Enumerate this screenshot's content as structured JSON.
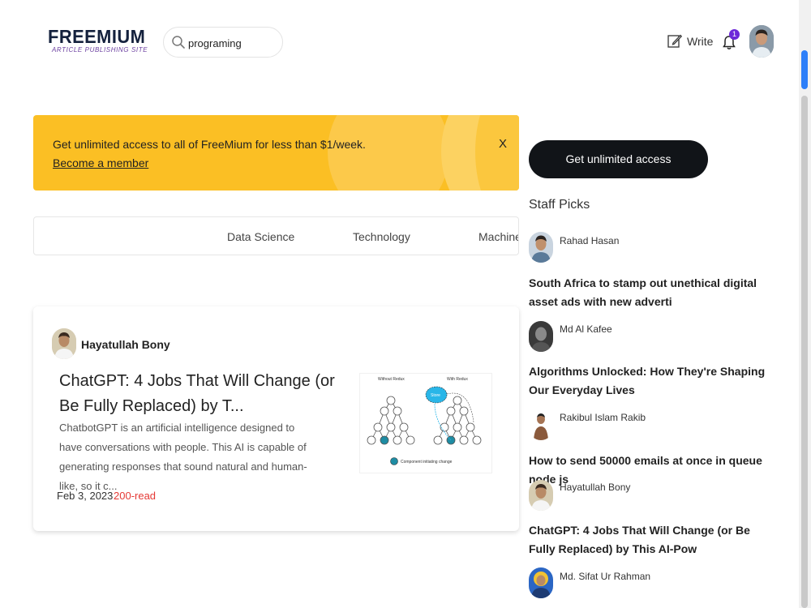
{
  "header": {
    "logo_title": "FREEMIUM",
    "logo_subtitle": "ARTICLE PUBLISHING SITE",
    "search_value": "programing",
    "write_label": "Write",
    "notification_count": "1"
  },
  "banner": {
    "text": "Get unlimited access to all of FreeMium for less than $1/week.",
    "link": "Become a member",
    "close": "X",
    "color": "#fbbf24"
  },
  "categories": [
    "Data Science",
    "Technology",
    "Machine L"
  ],
  "article": {
    "author": "Hayatullah Bony",
    "title": "ChatGPT: 4 Jobs That Will Change (or Be Fully Replaced) by T...",
    "excerpt": "ChatbotGPT is an artificial intelligence designed to have conversations with people. This AI is capable of generating responses that sound natural and human-like, so it c...",
    "date": "Feb 3, 2023",
    "reads": "200-read",
    "thumb_labels": {
      "left": "Without Redux",
      "right": "With Redux",
      "store": "Store",
      "legend": "Component initiating change"
    }
  },
  "sidebar": {
    "cta": "Get unlimited access",
    "staff_title": "Staff Picks",
    "picks": [
      {
        "author": "Rahad Hasan",
        "title": "South Africa to stamp out unethical digital asset ads with new adverti"
      },
      {
        "author": "Md Al Kafee",
        "title": "Algorithms Unlocked: How They're Shaping Our Everyday Lives"
      },
      {
        "author": "Rakibul Islam Rakib",
        "title": "How to send 50000 emails at once in queue node js"
      },
      {
        "author": "Hayatullah Bony",
        "title": "ChatGPT: 4 Jobs That Will Change (or Be Fully Replaced) by This AI-Pow"
      },
      {
        "author": "Md. Sifat Ur Rahman",
        "title": ""
      }
    ]
  },
  "colors": {
    "accent": "#6d28d9",
    "cta_bg": "#111418",
    "read_count": "#e53935",
    "scroll_thumb": "#2d7ff9"
  }
}
